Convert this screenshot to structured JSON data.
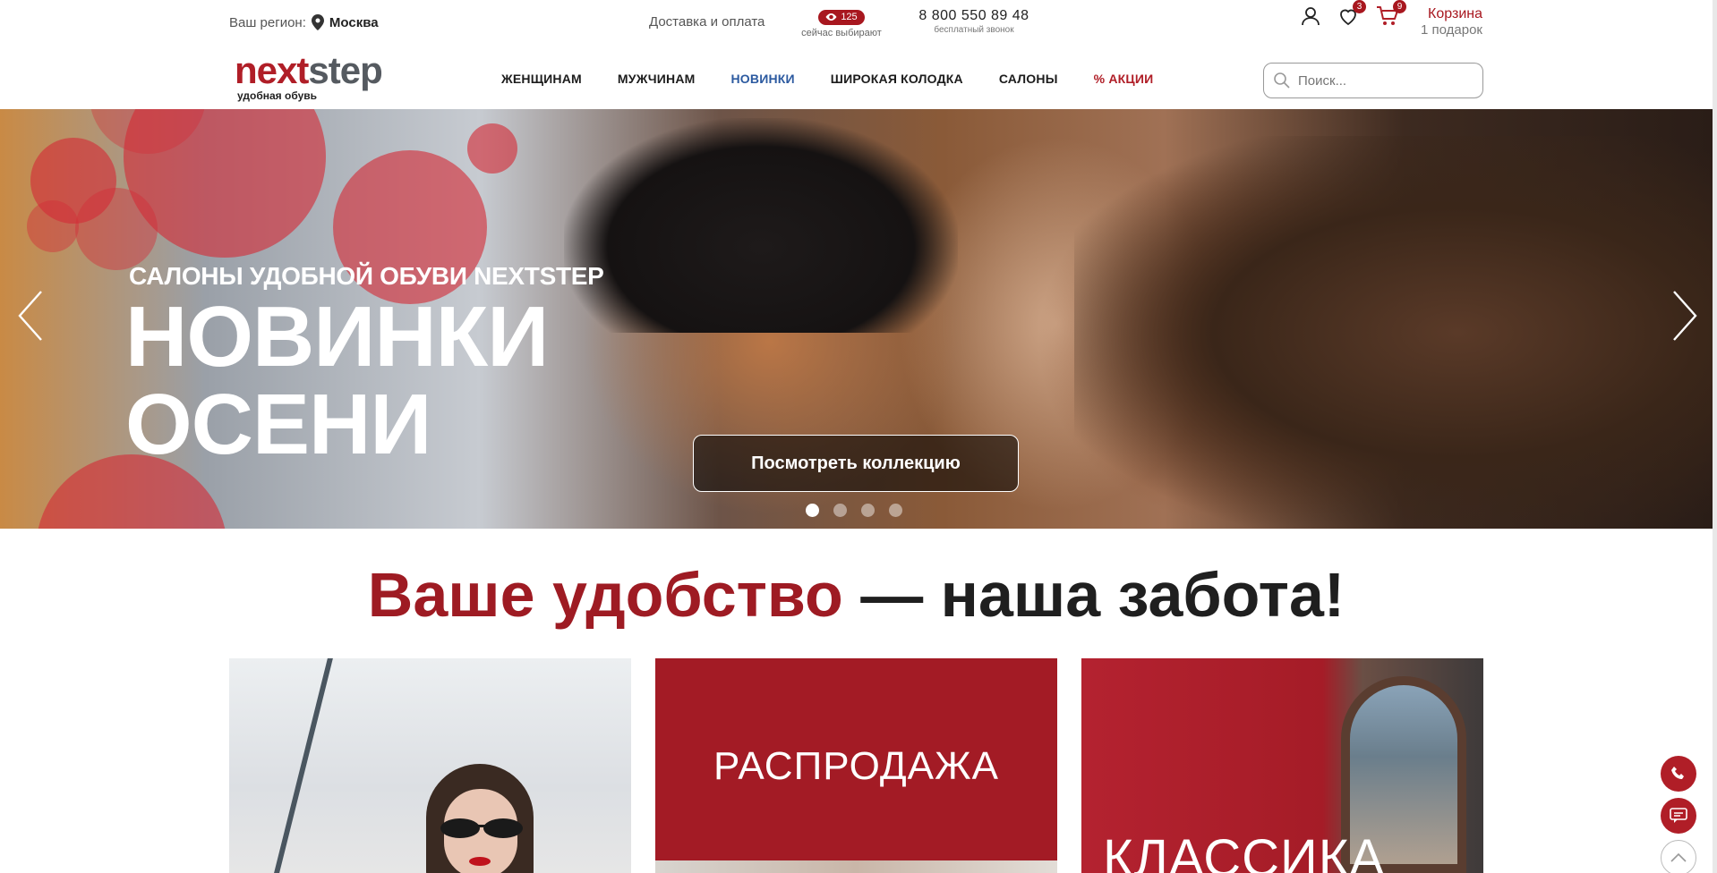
{
  "topbar": {
    "region_label": "Ваш регион:",
    "city": "Москва",
    "delivery": "Доставка и оплата",
    "viewers_count": "125",
    "viewers_sub": "сейчас выбирают",
    "phone": "8 800 550 89 48",
    "phone_sub": "бесплатный звонок",
    "wishlist_count": "3",
    "cart_count": "9",
    "cart_label": "Корзина",
    "cart_gift": "1 подарок"
  },
  "logo": {
    "next": "next",
    "step": "step",
    "tagline": "удобная обувь"
  },
  "nav": {
    "women": "ЖЕНЩИНАМ",
    "men": "МУЖЧИНАМ",
    "new": "НОВИНКИ",
    "wide": "ШИРОКАЯ КОЛОДКА",
    "salons": "САЛОНЫ",
    "sale": "% АКЦИИ"
  },
  "search": {
    "placeholder": "Поиск..."
  },
  "hero": {
    "subtitle": "САЛОНЫ УДОБНОЙ ОБУВИ NEXTSTEP",
    "title_line1": "НОВИНКИ",
    "title_line2": "ОСЕНИ",
    "cta": "Посмотреть коллекцию",
    "slide_count": 4,
    "active_slide": 1
  },
  "tagline": {
    "red": "Ваше удобство",
    "dark": " — наша забота!"
  },
  "tiles": {
    "sale": "РАСПРОДАЖА",
    "classic": "КЛАССИКА"
  },
  "colors": {
    "brand_red": "#a8171f",
    "nav_blue": "#2c5aa0",
    "logo_gray": "#555a60"
  }
}
